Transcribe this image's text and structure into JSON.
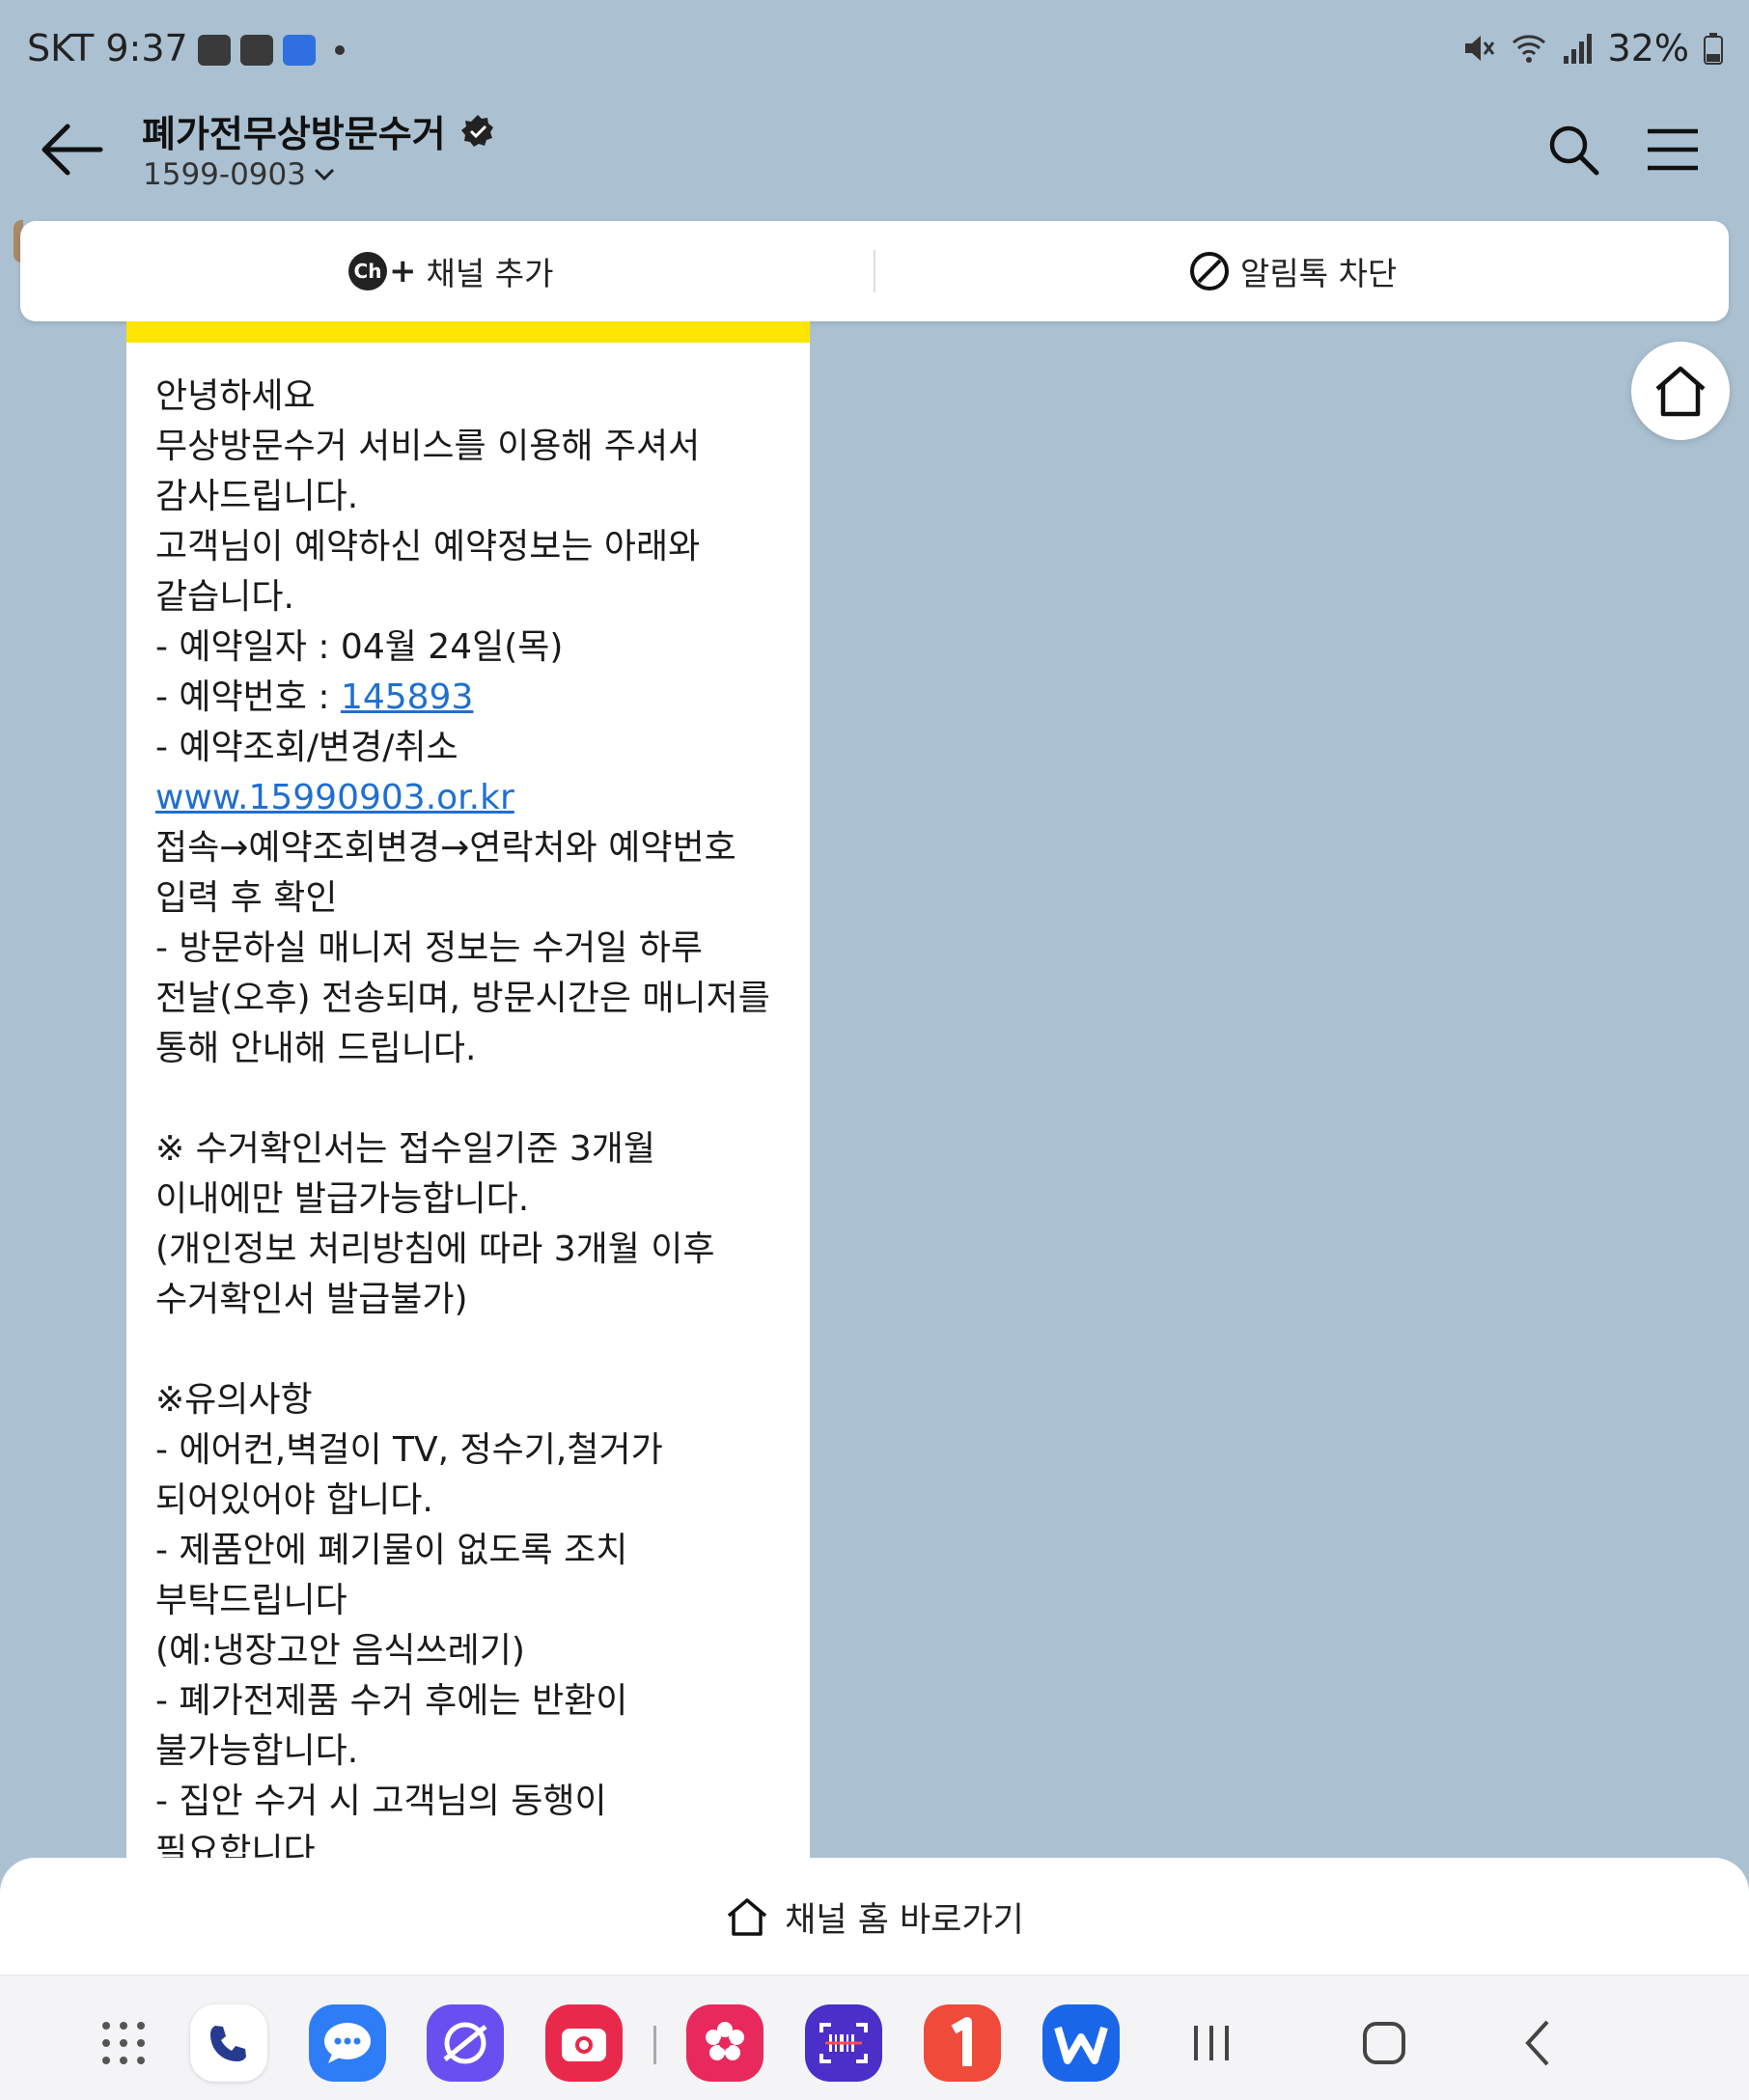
{
  "status_bar": {
    "time": "SKT 9:37",
    "battery": "32%",
    "icons": [
      "gallery-icon",
      "calendar-icon",
      "tmap-icon",
      "mute-icon",
      "wifi-icon",
      "signal-icon",
      "battery-icon"
    ]
  },
  "header": {
    "title": "폐가전무상방문수거",
    "phone": "1599-0903",
    "icons": [
      "back-arrow-icon",
      "verified-badge-icon",
      "chevron-down-icon",
      "search-icon",
      "menu-icon"
    ]
  },
  "channel_bar": {
    "add_label": "채널 추가",
    "add_badge": "Ch",
    "add_plus": "+",
    "block_label": "알림톡 차단"
  },
  "message": {
    "lines": [
      "안녕하세요",
      "무상방문수거 서비스를 이용해 주셔서",
      "감사드립니다.",
      "고객님이 예약하신 예약정보는 아래와",
      "같습니다.",
      "- 예약일자 : 04월 24일(목)",
      "- 예약번호 : ",
      "145893",
      "- 예약조회/변경/취소",
      "www.15990903.or.kr",
      "접속→예약조회변경→연락처와 예약번호",
      "입력 후 확인",
      "- 방문하실 매니저 정보는 수거일 하루",
      "전날(오후) 전송되며, 방문시간은 매니저를",
      "통해 안내해 드립니다.",
      "※ 수거확인서는 접수일기준 3개월",
      "이내에만 발급가능합니다.",
      "(개인정보 처리방침에 따라 3개월 이후",
      "수거확인서 발급불가)",
      "※유의사항",
      "- 에어컨,벽걸이 TV, 정수기,철거가",
      "되어있어야 합니다.",
      "- 제품안에 폐기물이 없도록 조치",
      "부탁드립니다",
      "(예:냉장고안 음식쓰레기)",
      "- 폐가전제품 수거 후에는 반환이",
      "불가능합니다.",
      "- 집안 수거 시 고객님의 동행이",
      "필요합니다"
    ]
  },
  "bottom_sheet": {
    "label": "채널 홈 바로가기"
  },
  "nav_bar": {
    "apps": [
      {
        "name": "app-drawer-icon",
        "color": "#ffffff"
      },
      {
        "name": "phone-app-icon",
        "color": "#ffffff"
      },
      {
        "name": "messages-app-icon",
        "color": "#2f7df6"
      },
      {
        "name": "internet-app-icon",
        "color": "#6a4ff0"
      },
      {
        "name": "camera-app-icon",
        "color": "#e8294c"
      },
      {
        "name": "flower-app-icon",
        "color": "#e8295e"
      },
      {
        "name": "scanner-app-icon",
        "color": "#4a2fc8"
      },
      {
        "name": "one-app-icon",
        "color": "#f04a3a"
      },
      {
        "name": "w-app-icon",
        "color": "#1a66e8"
      }
    ],
    "buttons": [
      "recents-button",
      "home-button",
      "back-button"
    ]
  }
}
